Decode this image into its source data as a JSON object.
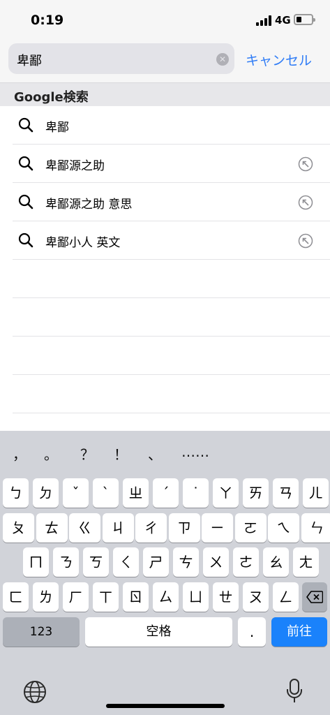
{
  "status": {
    "time": "0:19",
    "network": "4G"
  },
  "search": {
    "query": "卑鄙",
    "cancel_label": "キャンセル"
  },
  "section": {
    "title": "Google検索"
  },
  "results": [
    {
      "label": "卑鄙",
      "has_fill_arrow": false
    },
    {
      "label": "卑鄙源之助",
      "has_fill_arrow": true
    },
    {
      "label": "卑鄙源之助 意思",
      "has_fill_arrow": true
    },
    {
      "label": "卑鄙小人 英文",
      "has_fill_arrow": true
    }
  ],
  "keyboard": {
    "punctuation": [
      "，",
      "。",
      "？",
      "！",
      "、",
      "……"
    ],
    "row1": [
      "ㄅ",
      "ㄉ",
      "ˇ",
      "ˋ",
      "ㄓ",
      "ˊ",
      "˙",
      "ㄚ",
      "ㄞ",
      "ㄢ",
      "ㄦ"
    ],
    "row2": [
      "ㄆ",
      "ㄊ",
      "ㄍ",
      "ㄐ",
      "ㄔ",
      "ㄗ",
      "ㄧ",
      "ㄛ",
      "ㄟ",
      "ㄣ"
    ],
    "row3": [
      "ㄇ",
      "ㄋ",
      "ㄎ",
      "ㄑ",
      "ㄕ",
      "ㄘ",
      "ㄨ",
      "ㄜ",
      "ㄠ",
      "ㄤ"
    ],
    "row4": [
      "ㄈ",
      "ㄌ",
      "ㄏ",
      "ㄒ",
      "ㄖ",
      "ㄙ",
      "ㄩ",
      "ㄝ",
      "ㄡ",
      "ㄥ"
    ],
    "numbers_label": "123",
    "space_label": "空格",
    "period_label": ".",
    "go_label": "前往"
  },
  "colors": {
    "accent": "#2f7cf6",
    "go_key": "#1a82fb"
  }
}
